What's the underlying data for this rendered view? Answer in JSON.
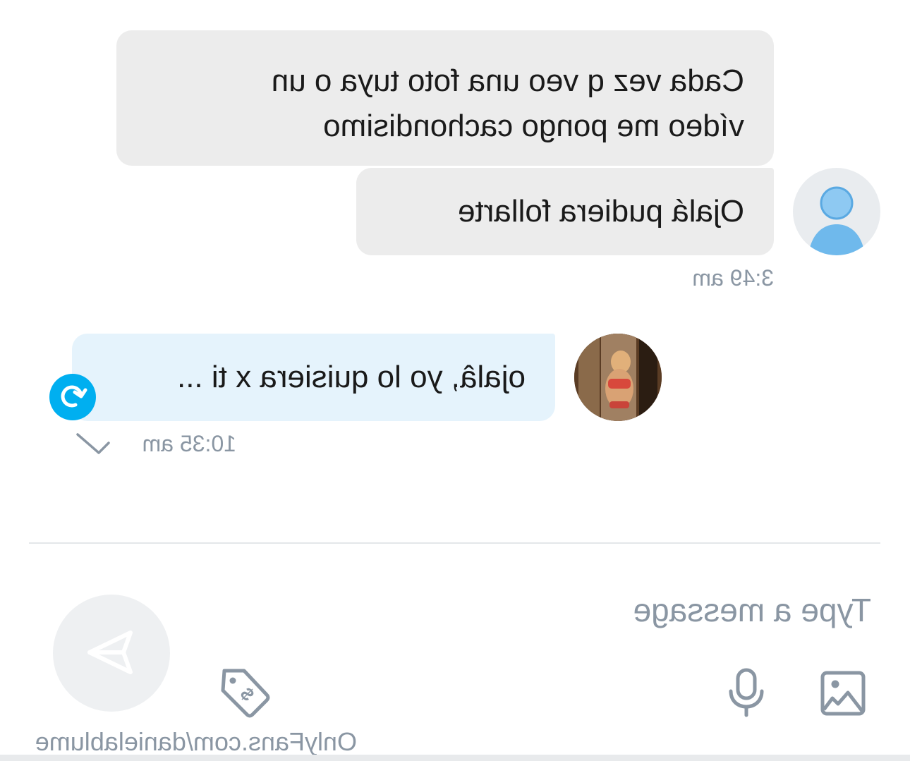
{
  "messages": [
    {
      "sender": "fan",
      "lines": [
        "Cada vez q veo una foto tuya o un",
        "vídeo me pongo cachondisimo"
      ]
    },
    {
      "sender": "fan",
      "lines": [
        "Ojalá pudiera follarte"
      ],
      "time": "3:49 am"
    },
    {
      "sender": "creator",
      "lines": [
        "ojalâ, yo lo quisiera x ti ..."
      ],
      "time": "10:35 am"
    }
  ],
  "composer": {
    "placeholder": "Type a message"
  },
  "footer": {
    "url": "OnlyFans.com/danielablume"
  },
  "colors": {
    "accent": "#00aff0",
    "bubble_in": "#ececec",
    "bubble_out": "#e5f3fc",
    "muted": "#8a96a3"
  },
  "icons": [
    "user-avatar-icon",
    "undo-icon",
    "check-icon",
    "send-icon",
    "price-tag-icon",
    "microphone-icon",
    "image-icon"
  ]
}
